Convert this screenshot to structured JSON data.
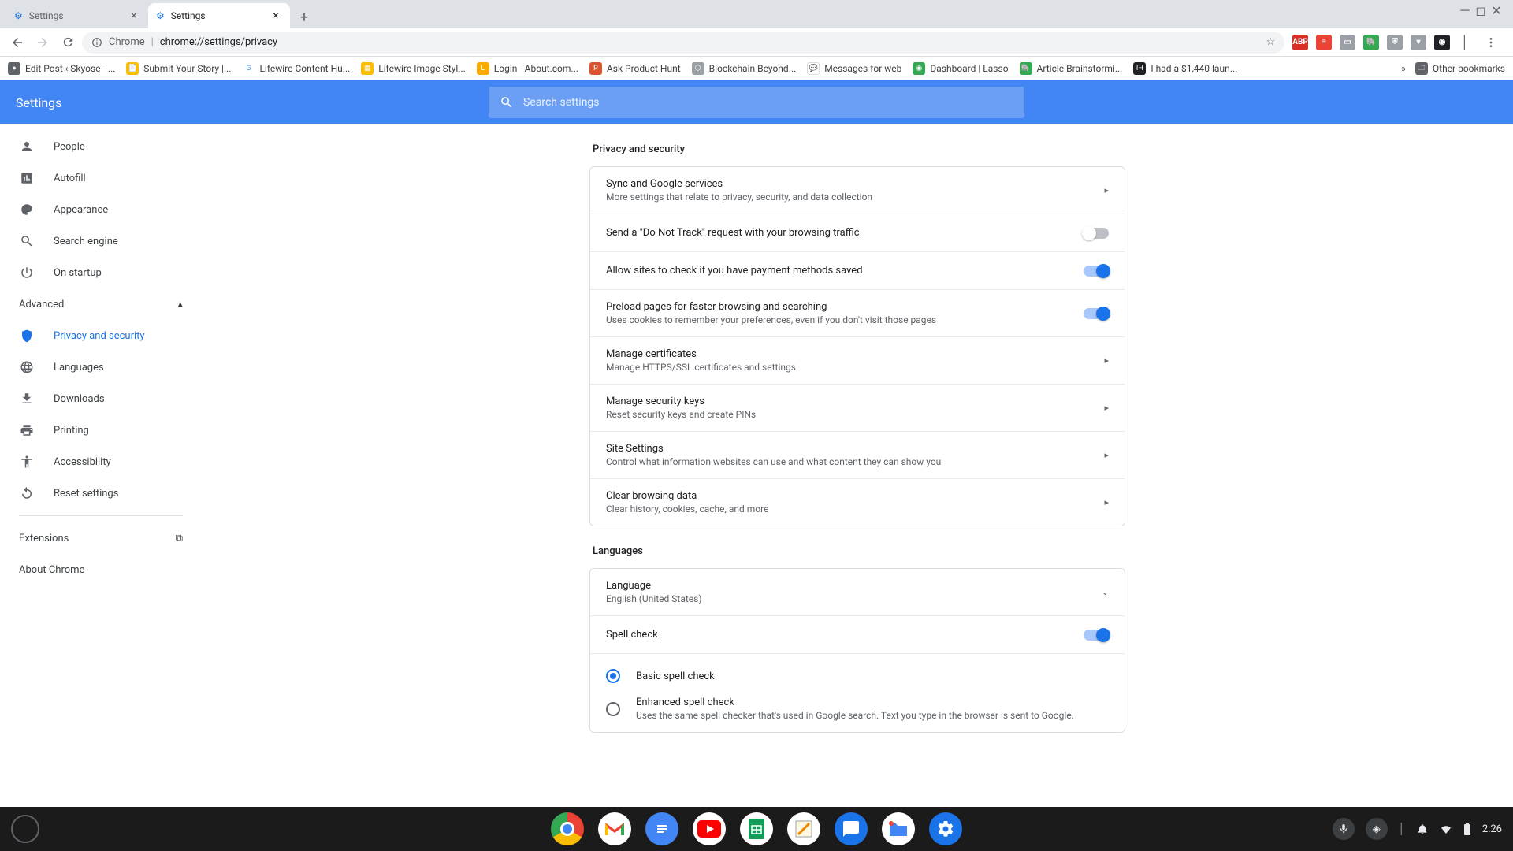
{
  "window": {
    "minimize": "_",
    "maximize": "◻",
    "close": "×"
  },
  "tabs": [
    {
      "title": "Settings",
      "active": false
    },
    {
      "title": "Settings",
      "active": true
    }
  ],
  "omnibox": {
    "scheme_label": "Chrome",
    "url": "chrome://settings/privacy"
  },
  "toolbar_icons": {
    "abp": "ABP",
    "more_exts": "»"
  },
  "bookmarks": [
    {
      "label": "Edit Post ‹ Skyose - ...",
      "color": "#5f6368"
    },
    {
      "label": "Submit Your Story |...",
      "color": "#fbbc04"
    },
    {
      "label": "Lifewire Content Hu...",
      "color": "#4285f4"
    },
    {
      "label": "Lifewire Image Styl...",
      "color": "#fbbc04"
    },
    {
      "label": "Login - About.com...",
      "color": "#f9ab00"
    },
    {
      "label": "Ask Product Hunt",
      "color": "#da552f"
    },
    {
      "label": "Blockchain Beyond...",
      "color": "#9aa0a6"
    },
    {
      "label": "Messages for web",
      "color": "#1a73e8"
    },
    {
      "label": "Dashboard | Lasso",
      "color": "#34a853"
    },
    {
      "label": "Article Brainstormi...",
      "color": "#34a853"
    },
    {
      "label": "I had a $1,440 laun...",
      "color": "#202124"
    }
  ],
  "bookmarks_right": {
    "overflow": "»",
    "other": "Other bookmarks"
  },
  "header": {
    "title": "Settings",
    "search_placeholder": "Search settings"
  },
  "sidebar": {
    "basic": [
      {
        "icon": "person",
        "label": "People"
      },
      {
        "icon": "autofill",
        "label": "Autofill"
      },
      {
        "icon": "palette",
        "label": "Appearance"
      },
      {
        "icon": "search",
        "label": "Search engine"
      },
      {
        "icon": "power",
        "label": "On startup"
      }
    ],
    "advanced_label": "Advanced",
    "advanced": [
      {
        "icon": "shield",
        "label": "Privacy and security",
        "active": true
      },
      {
        "icon": "globe",
        "label": "Languages"
      },
      {
        "icon": "download",
        "label": "Downloads"
      },
      {
        "icon": "print",
        "label": "Printing"
      },
      {
        "icon": "accessibility",
        "label": "Accessibility"
      },
      {
        "icon": "reset",
        "label": "Reset settings"
      }
    ],
    "extensions": "Extensions",
    "about": "About Chrome"
  },
  "sections": {
    "privacy_title": "Privacy and security",
    "privacy_rows": [
      {
        "title": "Sync and Google services",
        "sub": "More settings that relate to privacy, security, and data collection",
        "type": "arrow"
      },
      {
        "title": "Send a \"Do Not Track\" request with your browsing traffic",
        "type": "toggle",
        "on": false
      },
      {
        "title": "Allow sites to check if you have payment methods saved",
        "type": "toggle",
        "on": true
      },
      {
        "title": "Preload pages for faster browsing and searching",
        "sub": "Uses cookies to remember your preferences, even if you don't visit those pages",
        "type": "toggle",
        "on": true
      },
      {
        "title": "Manage certificates",
        "sub": "Manage HTTPS/SSL certificates and settings",
        "type": "arrow"
      },
      {
        "title": "Manage security keys",
        "sub": "Reset security keys and create PINs",
        "type": "arrow"
      },
      {
        "title": "Site Settings",
        "sub": "Control what information websites can use and what content they can show you",
        "type": "arrow"
      },
      {
        "title": "Clear browsing data",
        "sub": "Clear history, cookies, cache, and more",
        "type": "arrow"
      }
    ],
    "languages_title": "Languages",
    "lang_rows": {
      "language": {
        "title": "Language",
        "sub": "English (United States)"
      },
      "spellcheck": {
        "title": "Spell check",
        "on": true
      },
      "basic": {
        "title": "Basic spell check",
        "checked": true
      },
      "enhanced": {
        "title": "Enhanced spell check",
        "sub": "Uses the same spell checker that's used in Google search. Text you type in the browser is sent to Google.",
        "checked": false
      }
    }
  },
  "shelf": {
    "apps": [
      "chrome",
      "gmail",
      "docs",
      "youtube",
      "sheets",
      "notes",
      "messages",
      "files",
      "settings"
    ],
    "status": {
      "time": "2:26"
    }
  }
}
